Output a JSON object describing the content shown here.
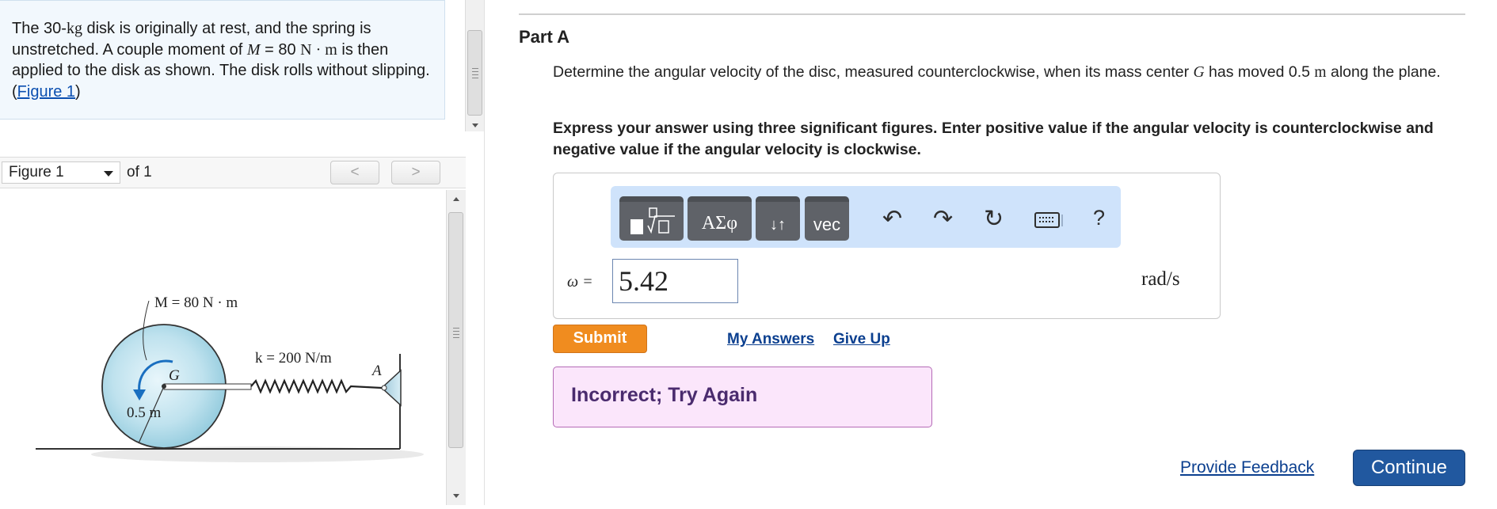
{
  "problem": {
    "text1": "The 30-",
    "mass_unit": "kg",
    "text2": " disk is originally at rest, and the spring is unstretched. A couple moment of ",
    "moment_sym": "M",
    "text3": " = 80 ",
    "moment_unit": "N · m",
    "text4": " is then applied to the disk as shown. The disk rolls without slipping. (",
    "figure_link": "Figure 1",
    "text5": ")"
  },
  "figure_nav": {
    "selected": "Figure 1",
    "of_label": "of 1",
    "prev": "<",
    "next": ">"
  },
  "figure": {
    "moment_label": "M = 80 N · m",
    "k_label": "k = 200 N/m",
    "a_label": "A",
    "g_label": "G",
    "r_label": "0.5 m"
  },
  "part": {
    "title": "Part A",
    "question_1": "Determine the angular velocity of the disc, measured counterclockwise, when its mass center ",
    "question_sym": "G",
    "question_2": " has moved 0.5 ",
    "question_unit": "m",
    "question_3": " along the plane.",
    "instructions": "Express your answer using three significant figures. Enter positive value if the angular velocity is counterclockwise and negative value if the angular velocity is clockwise."
  },
  "toolbar": {
    "templates_icon": "templates-icon",
    "greek_label": "ΑΣφ",
    "sort_label": "↓↑",
    "vec_label": "vec",
    "icons": [
      "undo-icon",
      "redo-icon",
      "reset-icon",
      "keyboard-icon",
      "help-icon"
    ],
    "help_label": "?"
  },
  "answer": {
    "variable_label": "ω =",
    "value": "5.42",
    "unit": "rad/s"
  },
  "actions": {
    "submit": "Submit",
    "my_answers": "My Answers",
    "give_up": "Give Up"
  },
  "feedback": {
    "message": "Incorrect; Try Again",
    "status_color": "#fbe6fb"
  },
  "footer": {
    "provide_feedback": "Provide Feedback",
    "continue": "Continue"
  },
  "colors": {
    "submit": "#f08c1f",
    "continue": "#21589f",
    "toolbar_bg": "#cfe3fb",
    "link": "#0b3f8f"
  }
}
